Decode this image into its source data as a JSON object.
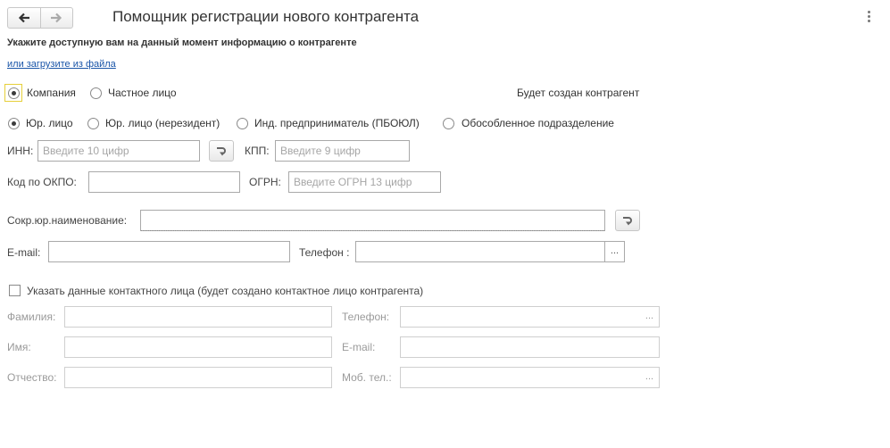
{
  "header": {
    "title": "Помощник регистрации нового контрагента",
    "hint": "Укажите доступную вам на данный момент информацию о контрагенте",
    "load_link": "или загрузите из файла"
  },
  "kind": {
    "options": [
      "Компания",
      "Частное лицо"
    ],
    "selected": "Компания",
    "result_text": "Будет создан контрагент"
  },
  "legal_form": {
    "options": [
      "Юр. лицо",
      "Юр. лицо (нерезидент)",
      "Инд. предприниматель (ПБОЮЛ)",
      "Обособленное подразделение"
    ],
    "selected": "Юр. лицо"
  },
  "fields": {
    "inn_label": "ИНН:",
    "inn_placeholder": "Введите 10 цифр",
    "kpp_label": "КПП:",
    "kpp_placeholder": "Введите 9 цифр",
    "okpo_label": "Код по ОКПО:",
    "ogrn_label": "ОГРН:",
    "ogrn_placeholder": "Введите ОГРН 13 цифр",
    "short_name_label": "Сокр.юр.наименование:",
    "email_label": "E-mail:",
    "phone_label": "Телефон :",
    "dots": "..."
  },
  "contact": {
    "checkbox_label": "Указать данные контактного лица (будет создано контактное лицо контрагента)",
    "checked": false,
    "surname_label": "Фамилия:",
    "name_label": "Имя:",
    "patronymic_label": "Отчество:",
    "phone_label": "Телефон:",
    "email_label": "E-mail:",
    "mobile_label": "Моб. тел.:",
    "dots": "..."
  }
}
